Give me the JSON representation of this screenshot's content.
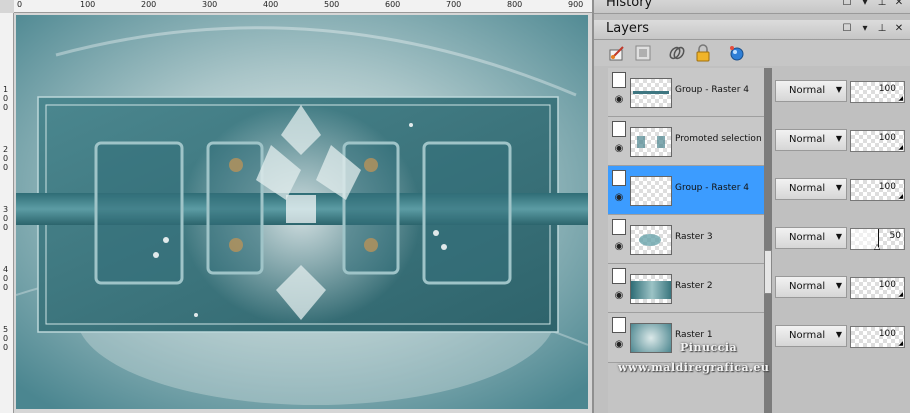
{
  "ruler": {
    "top_ticks": [
      "0",
      "100",
      "200",
      "300",
      "400",
      "500",
      "600",
      "700",
      "800",
      "900"
    ],
    "left_ticks": [
      "1\n0\n0",
      "2\n0\n0",
      "3\n0\n0",
      "4\n0\n0",
      "5\n0\n0"
    ]
  },
  "history_panel": {
    "title": "History"
  },
  "layers_panel": {
    "title": "Layers",
    "toolbar_icons": [
      "paintbrush-icon",
      "mask-icon",
      "link-icon",
      "lock-icon",
      "sphere-icon"
    ],
    "layers": [
      {
        "name": "Group - Raster 4",
        "blend_mode": "Normal",
        "opacity": "100",
        "selected": false
      },
      {
        "name": "Promoted selection",
        "blend_mode": "Normal",
        "opacity": "100",
        "selected": false
      },
      {
        "name": "Group - Raster 4",
        "blend_mode": "Normal",
        "opacity": "100",
        "selected": true
      },
      {
        "name": "Raster 3",
        "blend_mode": "Normal",
        "opacity": "50",
        "selected": false
      },
      {
        "name": "Raster 2",
        "blend_mode": "Normal",
        "opacity": "100",
        "selected": false
      },
      {
        "name": "Raster 1",
        "blend_mode": "Normal",
        "opacity": "100",
        "selected": false
      }
    ]
  },
  "watermark": {
    "line1": "Pinuccia",
    "line2": "www.maldiregrafica.eu"
  },
  "colors": {
    "selection": "#3c9cff",
    "canvas_teal": "#4e8a94",
    "panel_bg": "#c0c0c0"
  }
}
